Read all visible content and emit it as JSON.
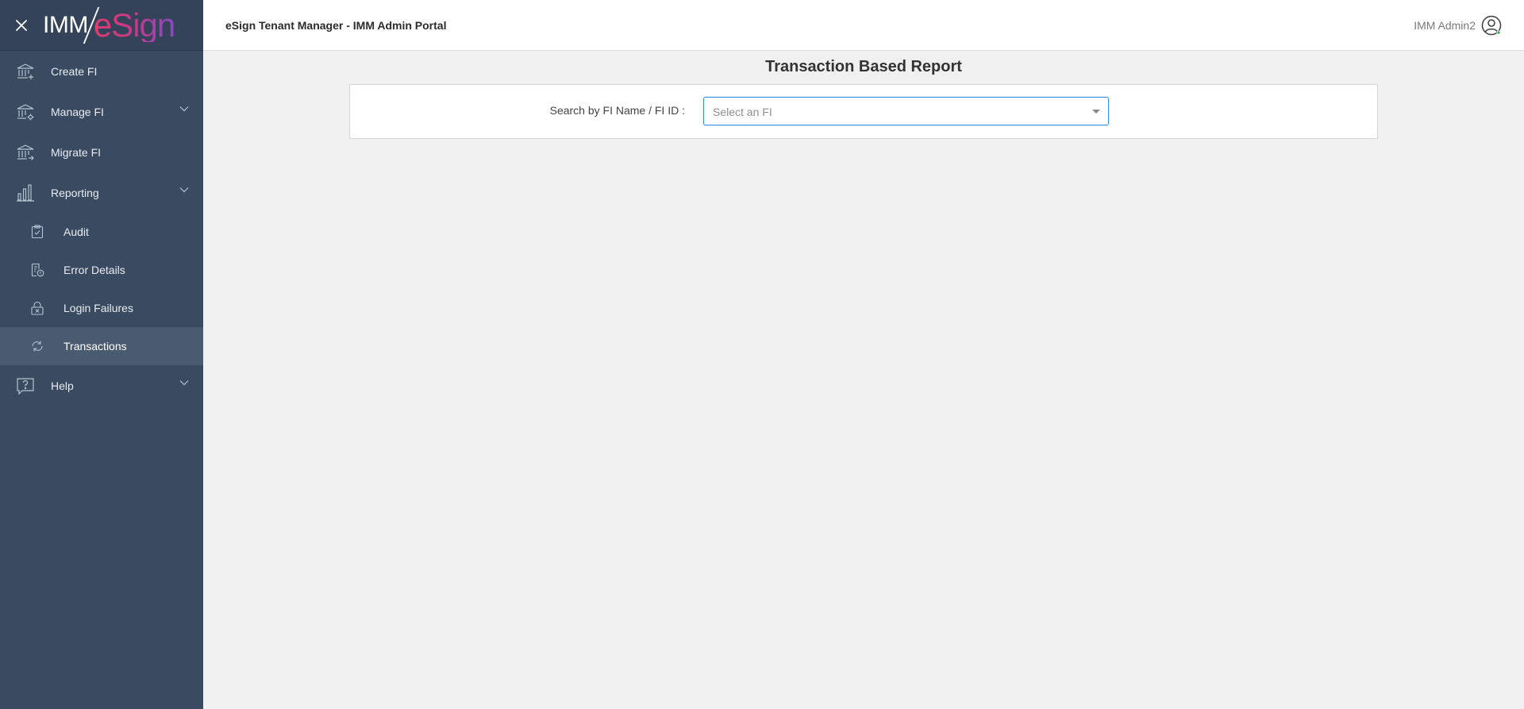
{
  "brand": {
    "logo_left": "IMM",
    "logo_right": "eSign",
    "colors": {
      "sidebar": "#3a4a61",
      "accent_pink": "#e33b6e",
      "accent_purple": "#8b48c4",
      "focus_blue": "#3b8ee3"
    }
  },
  "header": {
    "title": "eSign Tenant Manager - IMM Admin Portal",
    "user_name": "IMM Admin2"
  },
  "sidebar": {
    "items": [
      {
        "label": "Create FI",
        "icon": "bank-plus-icon"
      },
      {
        "label": "Manage FI",
        "icon": "bank-gear-icon",
        "expandable": true
      },
      {
        "label": "Migrate FI",
        "icon": "bank-arrow-icon"
      },
      {
        "label": "Reporting",
        "icon": "bar-chart-icon",
        "expandable": true,
        "expanded": true
      },
      {
        "label": "Help",
        "icon": "help-bubble-icon",
        "expandable": true
      }
    ],
    "reporting_children": [
      {
        "label": "Audit",
        "icon": "clipboard-check-icon"
      },
      {
        "label": "Error Details",
        "icon": "document-error-icon"
      },
      {
        "label": "Login Failures",
        "icon": "lock-x-icon"
      },
      {
        "label": "Transactions",
        "icon": "exchange-icon",
        "active": true
      }
    ]
  },
  "main": {
    "page_title": "Transaction Based Report",
    "search_label": "Search by FI Name / FI ID :",
    "fi_select": {
      "placeholder": "Select an FI",
      "value": ""
    }
  }
}
